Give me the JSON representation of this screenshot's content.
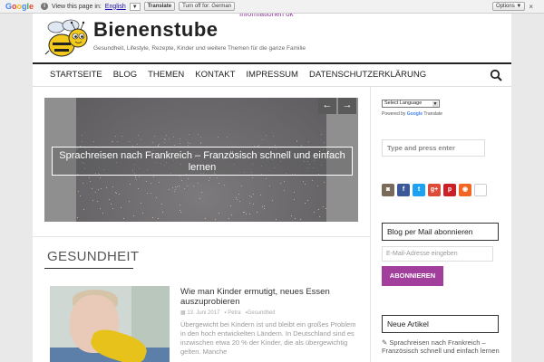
{
  "translate_bar": {
    "logo": "Google",
    "view_text": "View this page in:",
    "language": "English",
    "translate_btn": "Translate",
    "turnoff_btn": "Turn off for: German",
    "options_btn": "Options ▼",
    "close": "×"
  },
  "header": {
    "top_partial": "Informationen     ok",
    "title": "Bienenstube",
    "tagline": "Gesundheit, Lifestyle, Rezepte, Kinder und weitere Themen für die ganze Familie"
  },
  "nav": {
    "items": [
      "STARTSEITE",
      "BLOG",
      "THEMEN",
      "KONTAKT",
      "IMPRESSUM",
      "DATENSCHUTZERKLÄRUNG"
    ]
  },
  "slider": {
    "caption": "Sprachreisen nach Frankreich – Französisch schnell und einfach lernen",
    "prev": "←",
    "next": "→"
  },
  "category": {
    "heading": "GESUNDHEIT"
  },
  "post": {
    "title": "Wie man Kinder ermutigt, neues Essen auszuprobieren",
    "date": "13. Juni 2017",
    "author": "Petra",
    "category": "Gesundheit",
    "excerpt": "Übergewicht bei Kindern ist und bleibt ein großes Problem in den hoch entwickelten Ländern. In Deutschland sind es inzwischen etwa 20 % der Kinder, die als übergewichtig gelten. Manche"
  },
  "sidebar": {
    "language_select": "Select Language",
    "powered_by": "Powered by",
    "powered_google": "Google",
    "powered_translate": "Translate",
    "search_placeholder": "Type and press enter",
    "mail_widget_title": "Blog per Mail abonnieren",
    "mail_placeholder": "E-Mail-Adresse eingeben",
    "subscribe_label": "ABONNIEREN",
    "new_articles_title": "Neue Artikel",
    "new_article_1": "Sprachreisen nach Frankreich – Französisch schnell und einfach lernen"
  },
  "colors": {
    "accent": "#a23e9b",
    "nav_border": "#222222"
  }
}
